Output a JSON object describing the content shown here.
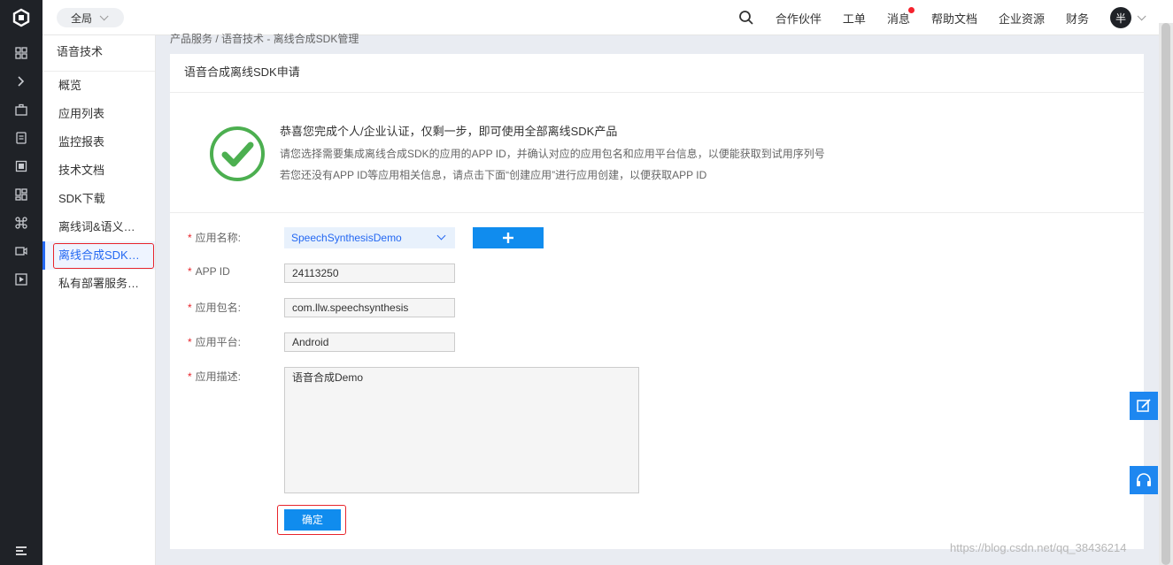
{
  "topbar": {
    "scope_label": "全局",
    "nav": [
      "合作伙伴",
      "工单",
      "消息",
      "帮助文档",
      "企业资源",
      "财务"
    ],
    "avatar_text": "半"
  },
  "rail_icons": [
    "grid-icon",
    "expand-icon",
    "briefcase-icon",
    "document-icon",
    "server-icon",
    "dashboard-icon",
    "network-icon",
    "video-icon",
    "play-icon"
  ],
  "subnav": {
    "title": "语音技术",
    "items": [
      "概览",
      "应用列表",
      "监控报表",
      "技术文档",
      "SDK下载",
      "离线词&语义…",
      "离线合成SDK…",
      "私有部署服务…"
    ],
    "active_index": 6
  },
  "breadcrumb": "产品服务 / 语音技术 - 离线合成SDK管理",
  "panel": {
    "title": "语音合成离线SDK申请",
    "notice": {
      "headline": "恭喜您完成个人/企业认证，仅剩一步，即可使用全部离线SDK产品",
      "line2": "请您选择需要集成离线合成SDK的应用的APP ID，并确认对应的应用包名和应用平台信息，以便能获取到试用序列号",
      "line3": "若您还没有APP ID等应用相关信息，请点击下面“创建应用”进行应用创建，以便获取APP ID"
    },
    "form": {
      "required_mark": "*",
      "app_name_label": "应用名称:",
      "app_name_value": "SpeechSynthesisDemo",
      "app_id_label": "APP ID",
      "app_id_value": "24113250",
      "package_label": "应用包名:",
      "package_value": "com.llw.speechsynthesis",
      "platform_label": "应用平台:",
      "platform_value": "Android",
      "desc_label": "应用描述:",
      "desc_value": "语音合成Demo",
      "submit_label": "确定"
    }
  },
  "watermark": "https://blog.csdn.net/qq_38436214",
  "colors": {
    "accent": "#108cee",
    "highlight": "#e8242b",
    "success": "#4caf50",
    "rail": "#1f2227"
  }
}
